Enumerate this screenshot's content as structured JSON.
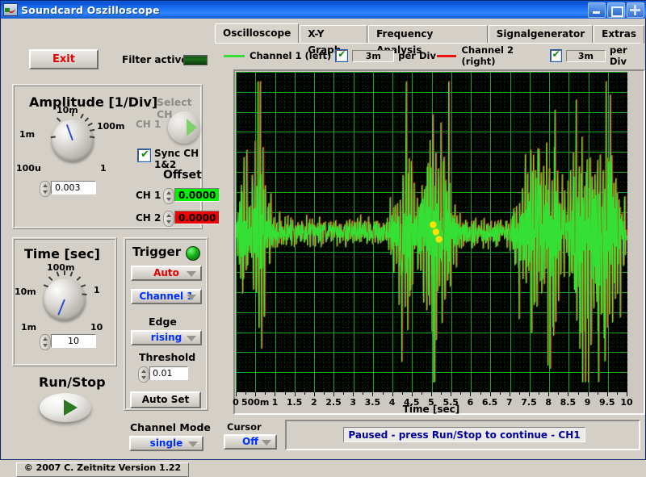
{
  "window": {
    "title": "Soundcard Oszilloscope",
    "buttons": {
      "minimize": "minimize-button",
      "maximize": "maximize-button",
      "close": "close-button"
    }
  },
  "left": {
    "exit_label": "Exit",
    "filter_label": "Filter active",
    "amplitude": {
      "title": "Amplitude [1/Div]",
      "tick_labels": [
        "1m",
        "10m",
        "100m",
        "1",
        "100u"
      ],
      "value": "0.003",
      "select_ch_title": "Select CH",
      "ch_label": "CH 1",
      "sync_label": "Sync CH 1&2",
      "sync_checked": "✔",
      "offset_title": "Offset",
      "offset_rows": [
        {
          "label": "CH 1",
          "value": "0.0000",
          "color": "#00f000"
        },
        {
          "label": "CH 2",
          "value": "0.0000",
          "color": "#f00000"
        }
      ]
    },
    "time": {
      "title": "Time [sec]",
      "tick_labels": [
        "10m",
        "100m",
        "1",
        "10",
        "1m"
      ],
      "value": "10"
    },
    "trigger": {
      "title": "Trigger",
      "mode": "Auto",
      "source": "Channel 1",
      "edge_title": "Edge",
      "edge": "rising",
      "threshold_title": "Threshold",
      "threshold": "0.01",
      "auto_set_label": "Auto Set"
    },
    "run_stop_label": "Run/Stop",
    "channel_mode_title": "Channel Mode",
    "channel_mode": "single",
    "copyright": "© 2007   C. Zeitnitz Version 1.22"
  },
  "right": {
    "tabs": [
      {
        "label": "Oscilloscope",
        "active": true
      },
      {
        "label": "X-Y Graph",
        "active": false
      },
      {
        "label": "Frequency Analysis",
        "active": false
      },
      {
        "label": "Signalgenerator",
        "active": false
      },
      {
        "label": "Extras",
        "active": false
      }
    ],
    "legend": [
      {
        "name": "Channel 1 (left)",
        "color": "#33e033",
        "checked": "✔",
        "per_div": "3m",
        "per_div_label": "per Div"
      },
      {
        "name": "Channel 2 (right)",
        "color": "#ee1111",
        "checked": "✔",
        "per_div": "3m",
        "per_div_label": "per Div"
      }
    ],
    "cursor_label": "Cursor",
    "cursor_value": "Off",
    "status": "Paused - press Run/Stop to continue - CH1"
  },
  "chart_data": {
    "type": "line",
    "title": "",
    "xlabel": "Time [sec]",
    "ylabel": "",
    "xlim": [
      0,
      10
    ],
    "ylim": [
      -0.015,
      0.015
    ],
    "grid": true,
    "background": "#000000",
    "grid_color": "#0b7a0b",
    "x_major_ticks": [
      0,
      0.5,
      1,
      1.5,
      2,
      2.5,
      3,
      3.5,
      4,
      4.5,
      5,
      5.5,
      6,
      6.5,
      7,
      7.5,
      8,
      8.5,
      9,
      9.5,
      10
    ],
    "x_tick_labels": [
      "0",
      "500m",
      "1",
      "1.5",
      "2",
      "2.5",
      "3",
      "3.5",
      "4",
      "4.5",
      "5",
      "5.5",
      "6",
      "6.5",
      "7",
      "7.5",
      "8",
      "8.5",
      "9",
      "9.5",
      "10"
    ],
    "series": [
      {
        "name": "Channel 1 (left)",
        "color": "#33e033",
        "description": "Audio waveform: low-level noise baseline with transient bursts",
        "envelope": [
          {
            "x": 0.0,
            "a": 0.04
          },
          {
            "x": 0.2,
            "a": 0.75
          },
          {
            "x": 0.32,
            "a": 0.25
          },
          {
            "x": 0.45,
            "a": 0.55
          },
          {
            "x": 0.62,
            "a": 0.95
          },
          {
            "x": 0.8,
            "a": 0.4
          },
          {
            "x": 1.0,
            "a": 0.12
          },
          {
            "x": 1.4,
            "a": 0.08
          },
          {
            "x": 2.0,
            "a": 0.07
          },
          {
            "x": 2.6,
            "a": 0.06
          },
          {
            "x": 3.2,
            "a": 0.07
          },
          {
            "x": 3.8,
            "a": 0.08
          },
          {
            "x": 4.2,
            "a": 0.45
          },
          {
            "x": 4.4,
            "a": 0.8
          },
          {
            "x": 4.6,
            "a": 0.3
          },
          {
            "x": 4.8,
            "a": 0.6
          },
          {
            "x": 5.0,
            "a": 0.95
          },
          {
            "x": 5.2,
            "a": 0.45
          },
          {
            "x": 5.4,
            "a": 0.7
          },
          {
            "x": 5.6,
            "a": 0.25
          },
          {
            "x": 5.9,
            "a": 0.1
          },
          {
            "x": 6.4,
            "a": 0.08
          },
          {
            "x": 7.0,
            "a": 0.1
          },
          {
            "x": 7.3,
            "a": 0.55
          },
          {
            "x": 7.6,
            "a": 0.85
          },
          {
            "x": 7.9,
            "a": 0.7
          },
          {
            "x": 8.2,
            "a": 0.8
          },
          {
            "x": 8.45,
            "a": 0.25
          },
          {
            "x": 8.7,
            "a": 1.0
          },
          {
            "x": 9.0,
            "a": 0.85
          },
          {
            "x": 9.3,
            "a": 0.75
          },
          {
            "x": 9.6,
            "a": 0.8
          },
          {
            "x": 9.85,
            "a": 0.35
          },
          {
            "x": 10.0,
            "a": 0.2
          }
        ]
      },
      {
        "name": "Channel 2 (right)",
        "color": "#cc2a12",
        "description": "Second channel, nearly identical and hidden beneath Channel 1"
      }
    ],
    "cursor_markers": {
      "color": "#ffe000",
      "x_positions": [
        5.05,
        5.12,
        5.2
      ]
    }
  }
}
